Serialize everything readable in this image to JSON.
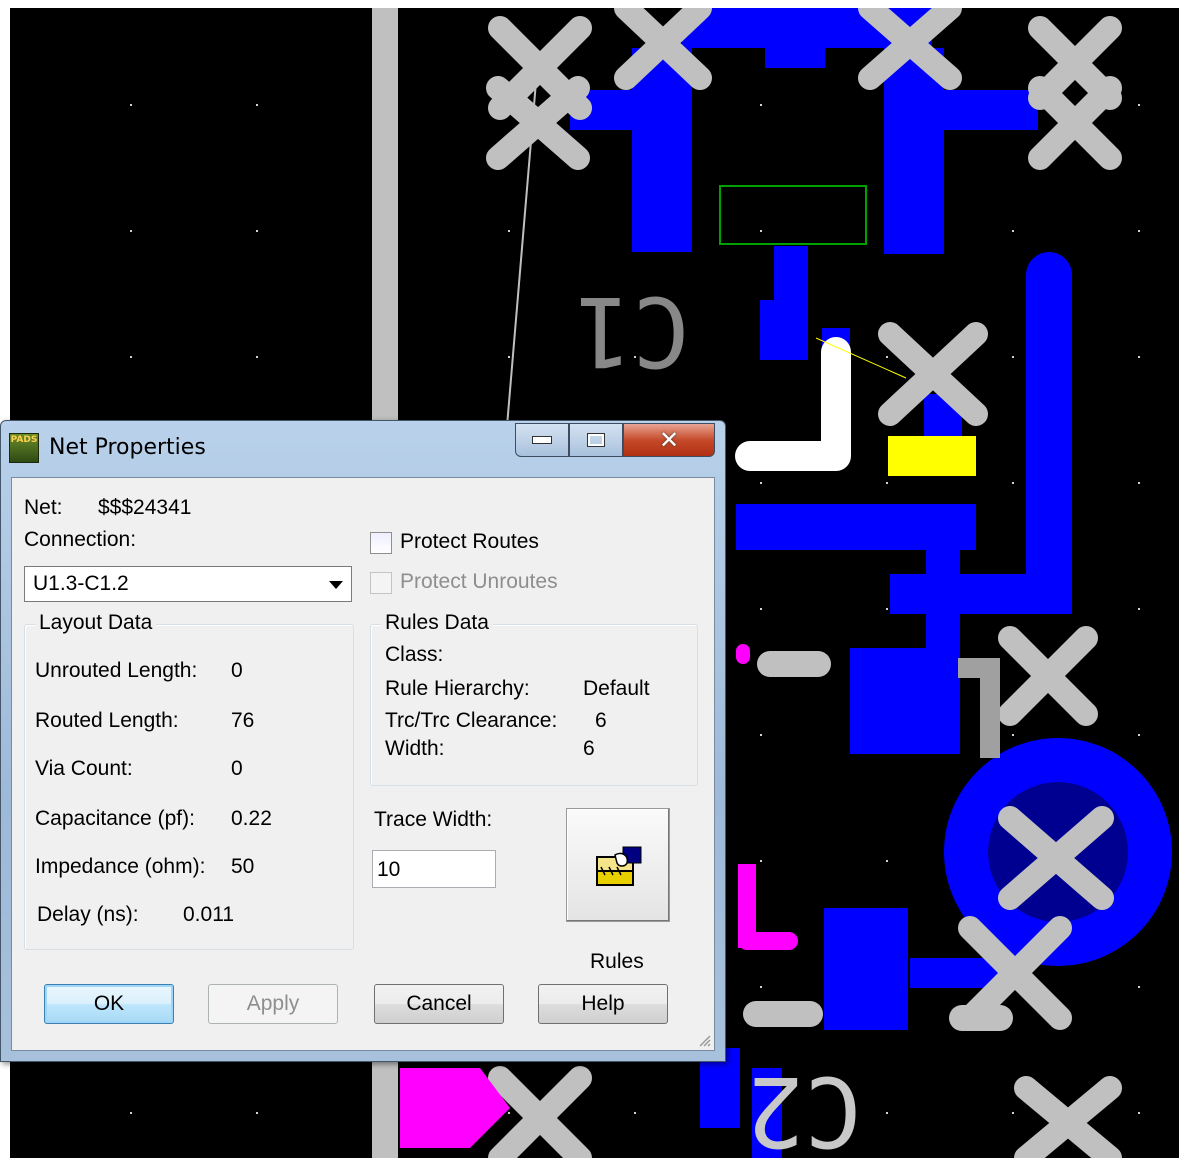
{
  "dialog": {
    "title": "Net Properties",
    "app_icon_text": "PADS",
    "caption_buttons": [
      "minimize",
      "maximize",
      "close"
    ],
    "close_glyph": "✕",
    "net_label": "Net:",
    "net_value": "$$$24341",
    "connection_label": "Connection:",
    "connection_value": "U1.3-C1.2",
    "protect_routes": {
      "label": "Protect Routes",
      "checked": false,
      "enabled": true
    },
    "protect_unroutes": {
      "label": "Protect Unroutes",
      "checked": false,
      "enabled": false
    },
    "layout_data": {
      "title": "Layout Data",
      "rows": [
        {
          "label": "Unrouted Length:",
          "value": "0"
        },
        {
          "label": "Routed Length:",
          "value": "76"
        },
        {
          "label": "Via Count:",
          "value": "0"
        },
        {
          "label": "Capacitance (pf):",
          "value": "0.22"
        },
        {
          "label": "Impedance (ohm):",
          "value": "50"
        },
        {
          "label": "Delay (ns):",
          "value": "0.011"
        }
      ]
    },
    "rules_data": {
      "title": "Rules Data",
      "class_label": "Class:",
      "class_value": "",
      "hierarchy_label": "Rule Hierarchy:",
      "hierarchy_value": "Default",
      "clearance_label": "Trc/Trc Clearance:",
      "clearance_value": "6",
      "width_label": "Width:",
      "width_value": "6"
    },
    "trace_width_label": "Trace Width:",
    "trace_width_value": "10",
    "rules_button_label": "Rules",
    "buttons": {
      "ok": "OK",
      "apply": "Apply",
      "cancel": "Cancel",
      "help": "Help"
    }
  },
  "pcb": {
    "silkscreen_labels": [
      "C1",
      "C2"
    ],
    "colors": {
      "background": "#000000",
      "trace": "#0000ff",
      "pad": "#c0c0c0",
      "selected": "#ffffff",
      "highlight": "#ffff00",
      "outline": "#00a000",
      "magenta": "#ff00ff"
    }
  }
}
